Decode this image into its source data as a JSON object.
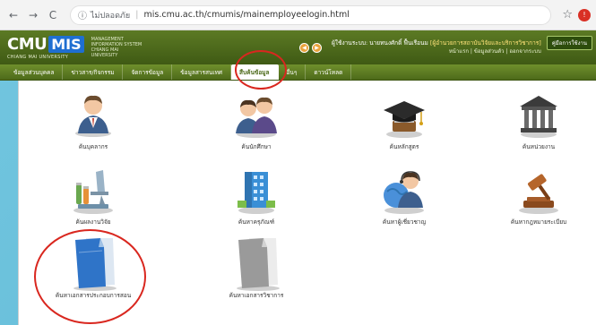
{
  "browser": {
    "back_icon": "←",
    "forward_icon": "→",
    "reload_icon": "C",
    "info_icon": "ⓘ",
    "security_label": "ไม่ปลอดภัย",
    "url": "mis.cmu.ac.th/cmumis/mainemployeelogin.html",
    "star_icon": "☆",
    "extension_icon": "!"
  },
  "header": {
    "logo_cmu": "CMU",
    "logo_mis": "MIS",
    "logo_sub": "CHIANG MAI UNIVERSITY",
    "logo_desc": "MANAGEMENT INFORMATION SYSTEM CHIANG MAI UNIVERSITY",
    "btn_a": "◀",
    "btn_b": "▶",
    "user_label": "ผู้ใช้งานระบบ:",
    "user_name": "นายทนงศักดิ์ ฟื้นเรือนม",
    "user_role": "[ผู้อำนวยการสถาบันวิจัยและบริการวิชาการ]",
    "user_links": "หน้าแรก | ข้อมูลส่วนตัว | ออกจากระบบ",
    "guide_button": "คู่มือการใช้งาน"
  },
  "nav": {
    "items": [
      {
        "label": "ข้อมูลส่วนบุคคล"
      },
      {
        "label": "ข่าวสาร/กิจกรรม"
      },
      {
        "label": "จัดการข้อมูล"
      },
      {
        "label": "ข้อมูลสารสนเทศ"
      },
      {
        "label": "สืบค้นข้อมูล"
      },
      {
        "label": "อื่นๆ"
      },
      {
        "label": "ดาวน์โหลด"
      }
    ]
  },
  "tiles": [
    {
      "label": "ค้นบุคลากร",
      "icon": "person-icon"
    },
    {
      "label": "ค้นนักศึกษา",
      "icon": "students-icon"
    },
    {
      "label": "ค้นหลักสูตร",
      "icon": "graduation-cap-icon"
    },
    {
      "label": "ค้นหน่วยงาน",
      "icon": "building-columns-icon"
    },
    {
      "label": "ค้นผลงานวิจัย",
      "icon": "microscope-icon"
    },
    {
      "label": "ค้นหาครุภัณฑ์",
      "icon": "office-building-icon"
    },
    {
      "label": "ค้นหาผู้เชี่ยวชาญ",
      "icon": "consultant-icon"
    },
    {
      "label": "ค้นหากฎหมายระเบียบ",
      "icon": "gavel-icon"
    },
    {
      "label": "ค้นหาเอกสารประกอบการสอน",
      "icon": "blue-document-icon"
    },
    {
      "label": "ค้นหาเอกสารวิชาการ",
      "icon": "grey-document-icon"
    }
  ],
  "colors": {
    "header_green": "#4d6a1a",
    "mis_blue": "#1f6fd1",
    "annotation_red": "#d9271f",
    "page_bg": "#6cc1dc"
  }
}
